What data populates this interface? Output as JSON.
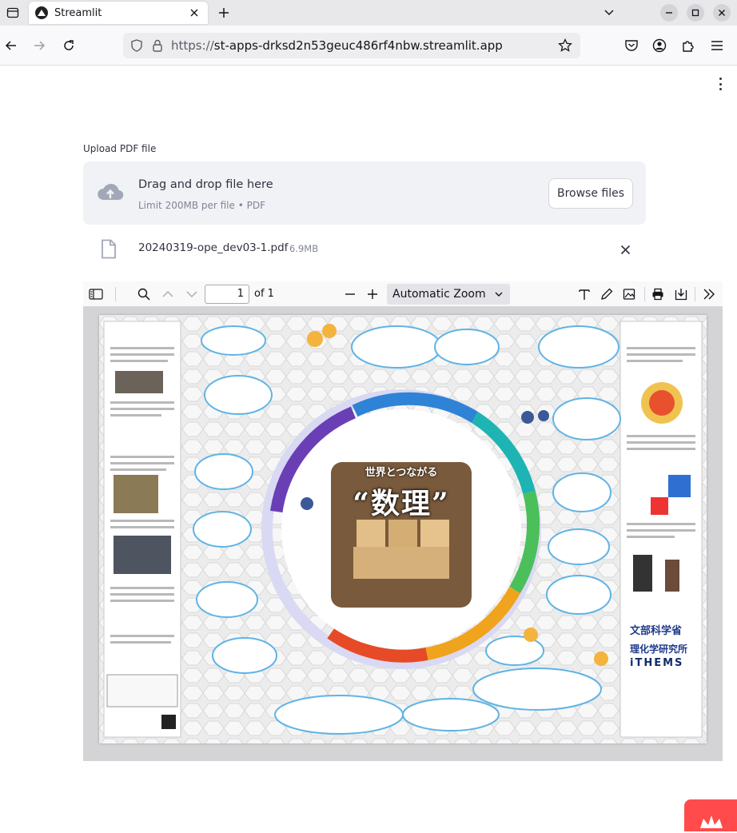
{
  "browser": {
    "tab_title": "Streamlit",
    "url_prefix": "https://",
    "url_host": "st-apps-drksd2n53geuc486rf4nbw.streamlit.app"
  },
  "uploader": {
    "label": "Upload PDF file",
    "drop_title": "Drag and drop file here",
    "drop_subtitle": "Limit 200MB per file • PDF",
    "browse_label": "Browse files"
  },
  "file": {
    "name": "20240319-ope_dev03-1.pdf",
    "size": "6.9MB"
  },
  "pdf_viewer": {
    "page_number": "1",
    "page_of": "of 1",
    "zoom": "Automatic Zoom"
  },
  "poster": {
    "title_line1": "世界とつながる",
    "title_line2": "“数理”",
    "logo_ministry": "文部科学省",
    "logo_riken": "理化学研究所",
    "logo_ithems": "iTHEMS"
  },
  "colors": {
    "accent": "#ff4b4b",
    "dropzone_bg": "#f0f2f6",
    "text": "#31333f"
  }
}
